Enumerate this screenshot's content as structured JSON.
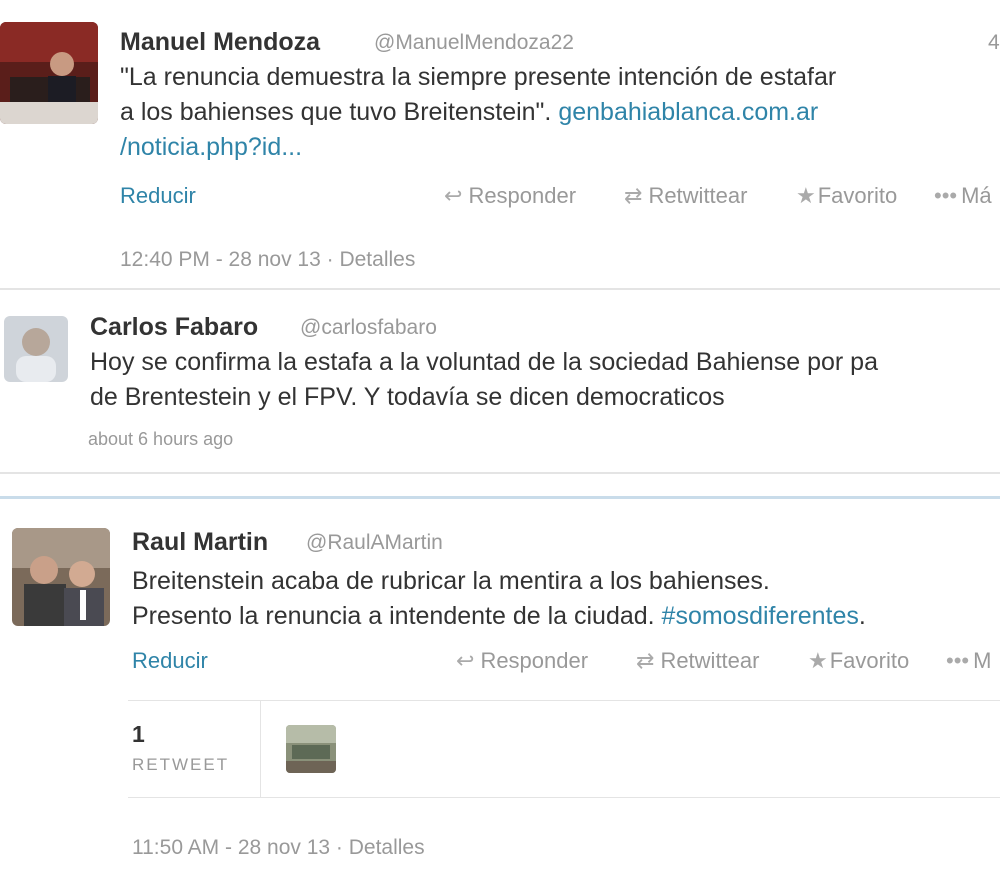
{
  "tweets": [
    {
      "name": "Manuel Mendoza",
      "handle": "@ManuelMendoza22",
      "time_short": "4",
      "text_line1": "\"La renuncia demuestra la siempre presente intención de estafar",
      "text_line2_plain": "a los  bahienses que tuvo Breitenstein\". ",
      "text_line2_link": "genbahiablanca.com.ar",
      "text_line3_link": "/noticia.php?id...",
      "reducir": "Reducir",
      "actions": {
        "reply": "Responder",
        "retweet": "Retwittear",
        "favorite": "Favorito",
        "more": "Má"
      },
      "footer": "12:40 PM - 28 nov 13 · Detalles"
    },
    {
      "name": "Carlos Fabaro",
      "handle": "@carlosfabaro",
      "text_line1": "Hoy se confirma la estafa a la voluntad de la sociedad Bahiense por pa",
      "text_line2": "de Brentestein y el FPV. Y todavía se dicen democraticos",
      "footer": "about 6 hours ago"
    },
    {
      "name": "Raul Martin",
      "handle": "@RaulAMartin",
      "text_line1": "Breitenstein acaba de rubricar la mentira a los bahienses.",
      "text_line2_plain": "Presento la renuncia a intendente de la ciudad. ",
      "text_line2_link": "#somosdiferentes",
      "text_line2_tail": ".",
      "reducir": "Reducir",
      "actions": {
        "reply": "Responder",
        "retweet": "Retwittear",
        "favorite": "Favorito",
        "more": "M"
      },
      "retweet_count": "1",
      "retweet_label": "RETWEET",
      "footer": "11:50 AM - 28 nov 13 · Detalles"
    }
  ],
  "colors": {
    "link": "#2f84a8",
    "muted": "#999999",
    "text": "#333333"
  },
  "icons": {
    "reply": "reply-arrow-icon",
    "retweet": "retweet-icon",
    "favorite": "star-icon",
    "more": "more-dots-icon"
  }
}
